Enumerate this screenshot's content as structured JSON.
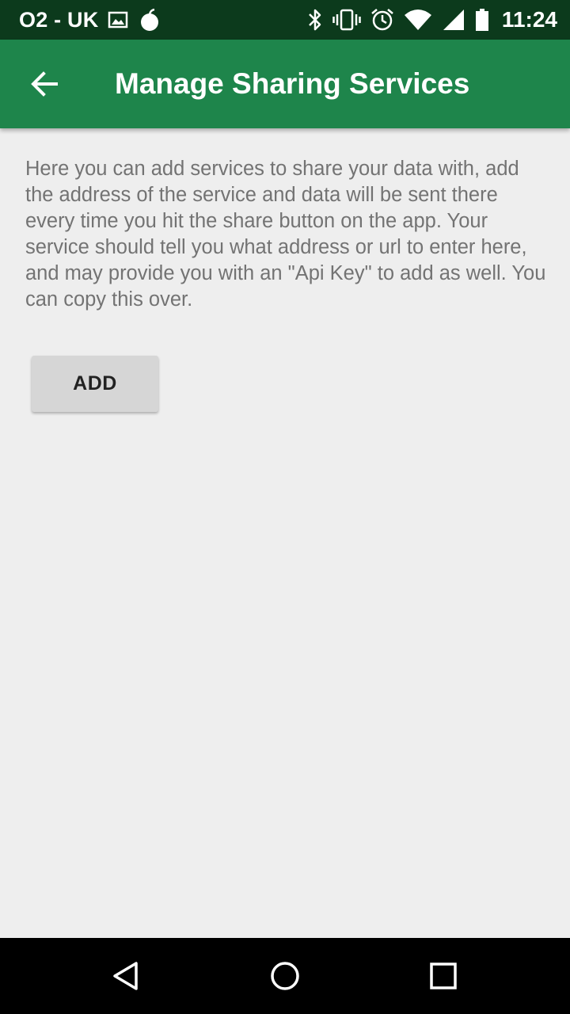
{
  "status_bar": {
    "carrier": "O2 - UK",
    "time": "11:24",
    "left_icons": [
      "image-icon",
      "apple-icon"
    ],
    "right_icons": [
      "bluetooth-icon",
      "vibrate-icon",
      "alarm-icon",
      "wifi-icon",
      "signal-icon",
      "battery-icon"
    ]
  },
  "app_bar": {
    "title": "Manage Sharing Services",
    "back_icon": "arrow-back-icon",
    "color": "#1e854b"
  },
  "content": {
    "description": "Here you can add services to share your data with, add the address of the service and data will be sent there every time you hit the share button on the app. Your service should tell you what address or url to enter here, and may provide you with an \"Api Key\" to add as well. You can copy this over.",
    "add_button_label": "ADD"
  },
  "nav_bar": {
    "icons": [
      "back-triangle-icon",
      "home-circle-icon",
      "recents-square-icon"
    ]
  }
}
